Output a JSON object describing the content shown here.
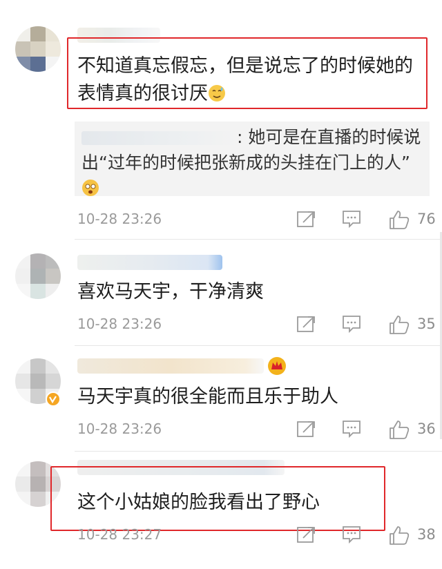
{
  "comments": [
    {
      "text": "不知道真忘假忘，但是说忘了的时候她的表情真的很讨厌",
      "emoji": "sweat-smile-emoji",
      "reply": {
        "text_prefix": ": 她可是在直播的时候说出",
        "text_quote": "“过年的时候把张新成的头挂在门上的人”",
        "emoji": "shocked-emoji"
      },
      "time": "10-28 23:26",
      "likes": "76",
      "highlighted": true
    },
    {
      "text": "喜欢马天宇，干净清爽",
      "time": "10-28 23:26",
      "likes": "35",
      "highlighted": false
    },
    {
      "text": "马天宇真的很全能而且乐于助人",
      "time": "10-28 23:26",
      "likes": "36",
      "badge": "verified-v-icon",
      "highlighted": false
    },
    {
      "text": "这个小姑娘的脸我看出了野心",
      "time": "10-28 23:27",
      "likes": "38",
      "highlighted": true
    }
  ],
  "colors": {
    "highlight_border": "#e0272a",
    "meta_text": "#9a9a9a",
    "reply_bg": "#f3f3f3"
  }
}
